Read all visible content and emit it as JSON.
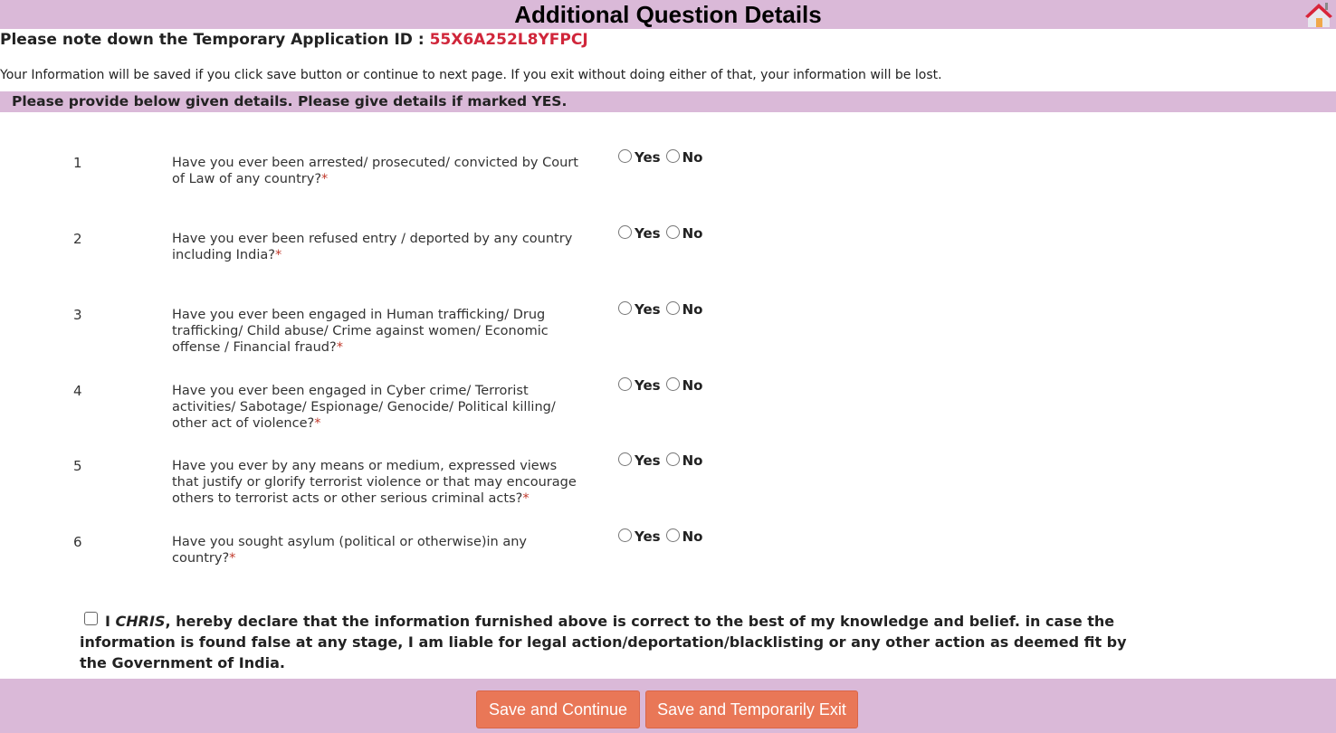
{
  "header": {
    "title": "Additional Question Details",
    "home_icon": "home-icon"
  },
  "application": {
    "id_label": "Please note down the Temporary Application ID : ",
    "id_value": "55X6A252L8YFPCJ"
  },
  "info_text": "Your Information will be saved if you click save button or continue to next page. If you exit without doing either of that, your information will be lost.",
  "section_heading": "Please provide below given details. Please give details if marked YES.",
  "options": {
    "yes": "Yes",
    "no": "No"
  },
  "required_marker": "*",
  "questions": [
    {
      "num": "1",
      "text": "Have you ever been arrested/ prosecuted/ convicted by Court of Law of any country?",
      "answer": null
    },
    {
      "num": "2",
      "text": "Have you ever been refused entry / deported by any country including India?",
      "answer": null
    },
    {
      "num": "3",
      "text": "Have you ever been engaged in Human trafficking/ Drug trafficking/ Child abuse/ Crime against women/ Economic offense / Financial fraud?",
      "answer": null
    },
    {
      "num": "4",
      "text": "Have you ever been engaged in Cyber crime/ Terrorist activities/ Sabotage/ Espionage/ Genocide/ Political killing/ other act of violence?",
      "answer": null
    },
    {
      "num": "5",
      "text": "Have you ever by any means or medium, expressed views that justify or glorify terrorist violence or that may encourage others to terrorist acts or other serious criminal acts?",
      "answer": null
    },
    {
      "num": "6",
      "text": "Have you sought asylum (political or otherwise)in any country?",
      "answer": null
    }
  ],
  "declaration": {
    "prefix": "I ",
    "name": "CHRIS",
    "text": ", hereby declare that the information furnished above is correct to the best of my knowledge and belief. in case the information is found false at any stage, I am liable for legal action/deportation/blacklisting or any other action as deemed fit by the Government of India.",
    "checked": false
  },
  "buttons": {
    "save_continue": "Save and Continue",
    "save_exit": "Save and Temporarily Exit"
  },
  "colors": {
    "band": "#dab9d8",
    "id_red": "#d0263a",
    "button": "#e97757"
  }
}
